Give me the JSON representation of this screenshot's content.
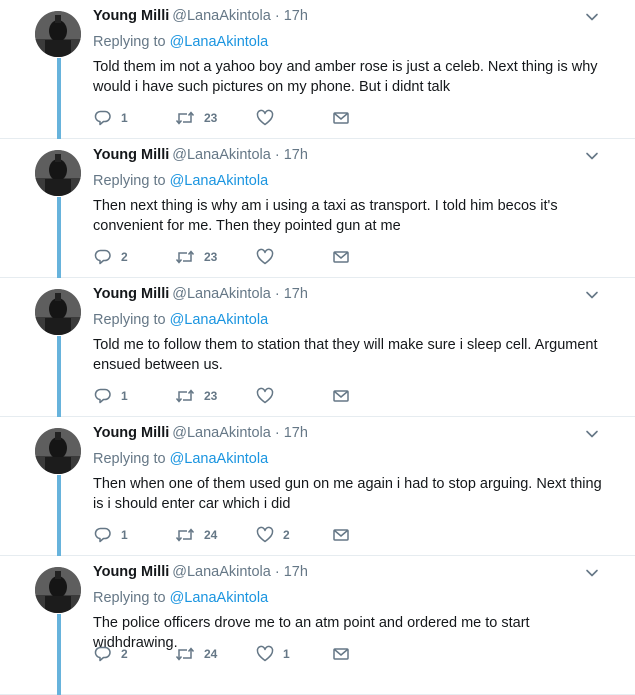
{
  "tweets": [
    {
      "name": "Young Milli",
      "handle": "@LanaAkintola",
      "dot": "·",
      "time": "17h",
      "replying_prefix": "Replying to",
      "replying_to": "@LanaAkintola",
      "text": "Told them im not a yahoo boy and amber rose is just a celeb. Next thing is why would i have such pictures on my phone. But i didnt talk",
      "replies": "1",
      "retweets": "23",
      "likes": ""
    },
    {
      "name": "Young Milli",
      "handle": "@LanaAkintola",
      "dot": "·",
      "time": "17h",
      "replying_prefix": "Replying to",
      "replying_to": "@LanaAkintola",
      "text": "Then next thing is why am i using a taxi as transport. I told him becos it's convenient for me. Then they pointed gun at me",
      "replies": "2",
      "retweets": "23",
      "likes": ""
    },
    {
      "name": "Young Milli",
      "handle": "@LanaAkintola",
      "dot": "·",
      "time": "17h",
      "replying_prefix": "Replying to",
      "replying_to": "@LanaAkintola",
      "text": "Told me to follow them to station that they will make sure i sleep cell. Argument ensued between us.",
      "replies": "1",
      "retweets": "23",
      "likes": ""
    },
    {
      "name": "Young Milli",
      "handle": "@LanaAkintola",
      "dot": "·",
      "time": "17h",
      "replying_prefix": "Replying to",
      "replying_to": "@LanaAkintola",
      "text": "Then when one of them used gun on me again i had to stop arguing. Next thing is i should enter car which i did",
      "replies": "1",
      "retweets": "24",
      "likes": "2"
    },
    {
      "name": "Young Milli",
      "handle": "@LanaAkintola",
      "dot": "·",
      "time": "17h",
      "replying_prefix": "Replying to",
      "replying_to": "@LanaAkintola",
      "text": "The police officers drove me to an atm point and ordered me to start widhdrawing.",
      "replies": "2",
      "retweets": "24",
      "likes": "1"
    }
  ],
  "icons": {
    "reply": "reply-icon",
    "retweet": "retweet-icon",
    "like": "heart-icon",
    "dm": "envelope-icon",
    "caret": "chevron-down-icon"
  },
  "colors": {
    "link": "#1b95e0",
    "muted": "#657786",
    "thread_line": "#67b3dc",
    "divider": "#e6ecf0"
  }
}
